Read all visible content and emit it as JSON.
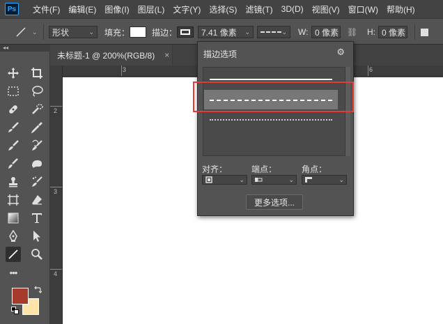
{
  "app": {
    "logo": "Ps"
  },
  "menu": [
    "文件(F)",
    "编辑(E)",
    "图像(I)",
    "图层(L)",
    "文字(Y)",
    "选择(S)",
    "滤镜(T)",
    "3D(D)",
    "视图(V)",
    "窗口(W)",
    "帮助(H)"
  ],
  "options": {
    "mode": "形状",
    "fill_label": "填充：",
    "stroke_label": "描边：",
    "stroke_width": "7.41 像素",
    "w_label": "W:",
    "w_value": "0 像素",
    "h_label": "H:",
    "h_value": "0 像素"
  },
  "document": {
    "tab_title": "未标题-1 @ 200%(RGB/8)",
    "close_symbol": "×",
    "ruler_top": [
      "3",
      "6"
    ],
    "ruler_left": [
      "2",
      "3",
      "4"
    ]
  },
  "panel": {
    "title": "描边选项",
    "align_label": "对齐：",
    "caps_label": "端点：",
    "corners_label": "角点：",
    "more_button": "更多选项...",
    "stroke_types": [
      "solid",
      "dashed",
      "dotted"
    ],
    "selected_stroke": "dashed"
  },
  "colors": {
    "foreground": "#a63a2b",
    "background": "#fde3a7",
    "highlight": "#e53935"
  },
  "icons": {
    "gear": "⚙",
    "collapse": "◂◂",
    "more_tools": "•••"
  }
}
